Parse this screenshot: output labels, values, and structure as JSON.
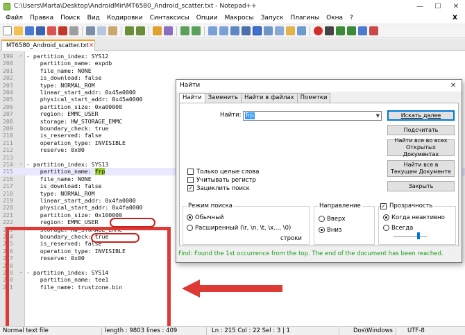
{
  "window": {
    "title": "C:\\Users\\Marta\\Desktop\\AndroidMir\\MT6580_Android_scatter.txt - Notepad++",
    "minimize": "—",
    "maximize": "☐",
    "close": "✕"
  },
  "menu": [
    "Файл",
    "Правка",
    "Поиск",
    "Вид",
    "Кодировки",
    "Синтаксисы",
    "Опции",
    "Макросы",
    "Запуск",
    "Плагины",
    "Окна",
    "?"
  ],
  "menu_close": "X",
  "tab": {
    "label": "MT6580_Android_scatter.txt",
    "close": "✕"
  },
  "lines": [
    {
      "n": "199",
      "fold": "−",
      "text": "- partition_index: SYS12"
    },
    {
      "n": "200",
      "text": "    partition_name: expdb"
    },
    {
      "n": "201",
      "text": "    file_name: NONE"
    },
    {
      "n": "202",
      "text": "    is_download: false"
    },
    {
      "n": "203",
      "text": "    type: NORMAL_ROM"
    },
    {
      "n": "204",
      "text": "    linear_start_addr: 0x45a0000"
    },
    {
      "n": "205",
      "text": "    physical_start_addr: 0x45a0000"
    },
    {
      "n": "206",
      "text": "    partition_size: 0xa00000"
    },
    {
      "n": "207",
      "text": "    region: EMMC_USER"
    },
    {
      "n": "208",
      "text": "    storage: HW_STORAGE_EMMC"
    },
    {
      "n": "209",
      "text": "    boundary_check: true"
    },
    {
      "n": "210",
      "text": "    is_reserved: false"
    },
    {
      "n": "211",
      "text": "    operation_type: INVISIBLE"
    },
    {
      "n": "212",
      "text": "    reserve: 0x00"
    },
    {
      "n": "213",
      "text": ""
    },
    {
      "n": "214",
      "fold": "−",
      "text": "- partition_index: SYS13"
    },
    {
      "n": "215",
      "text": "    partition_name: ",
      "hl": "frp",
      "current": true
    },
    {
      "n": "216",
      "text": "    file_name: NONE"
    },
    {
      "n": "217",
      "text": "    is_download: false"
    },
    {
      "n": "218",
      "text": "    type: NORMAL_ROM"
    },
    {
      "n": "219",
      "text": "    linear_start_addr: 0x4fa0000"
    },
    {
      "n": "220",
      "text": "    physical_start_addr: 0x4fa0000"
    },
    {
      "n": "221",
      "text": "    partition_size: 0x100000"
    },
    {
      "n": "222",
      "text": "    region: EMMC_USER"
    },
    {
      "n": "223",
      "text": "    storage: HW_STORAGE_EMMC"
    },
    {
      "n": "224",
      "text": "    boundary_check: true"
    },
    {
      "n": "225",
      "text": "    is_reserved: false"
    },
    {
      "n": "226",
      "text": "    operation_type: INVISIBLE"
    },
    {
      "n": "227",
      "text": "    reserve: 0x00"
    },
    {
      "n": "228",
      "text": ""
    },
    {
      "n": "229",
      "fold": "−",
      "text": "- partition_index: SYS14"
    },
    {
      "n": "230",
      "text": "    partition_name: tee1"
    },
    {
      "n": "231",
      "text": "    file_name: trustzone.bin"
    }
  ],
  "dialog": {
    "title": "Найти",
    "close": "✕",
    "tabs": [
      "Найти",
      "Заменить",
      "Найти в файлах",
      "Пометки"
    ],
    "find_label": "Найти:",
    "find_value": "frp",
    "buttons": {
      "find_next": "Искать далее",
      "count": "Подсчитать",
      "find_all_open_1": "Найти все во всех",
      "find_all_open_2": "Открытых Документах",
      "find_all_current_1": "Найти все в",
      "find_all_current_2": "Текущем Документе",
      "close": "Закрыть"
    },
    "options": {
      "whole_word": "Только целые слова",
      "match_case": "Учитывать регистр",
      "wrap": "Зациклить поиск"
    },
    "search_mode": {
      "title": "Режим поиска",
      "normal": "Обычный",
      "extended": "Расширенный (\\r, \\n, \\t, \\x..., \\0)",
      "regex_suffix": "строки"
    },
    "direction": {
      "title": "Направление",
      "up": "Вверх",
      "down": "Вниз"
    },
    "transparency": {
      "title": "Прозрачность",
      "on_losing_focus": "Когда неактивно",
      "always": "Всегда"
    },
    "status": "Find: Found the 1st occurrence from the top. The end of the document has been reached."
  },
  "status": {
    "type": "Normal text file",
    "length": "length : 9803",
    "lines": "lines : 409",
    "position": "Ln : 215    Col : 22    Sel : 3 | 1",
    "eol": "Dos\\Windows",
    "encoding": "UTF-8"
  },
  "colors": {
    "annotation_red": "#dd3a36",
    "match_highlight": "#9acd32",
    "dialog_status": "#1a9c1a"
  }
}
